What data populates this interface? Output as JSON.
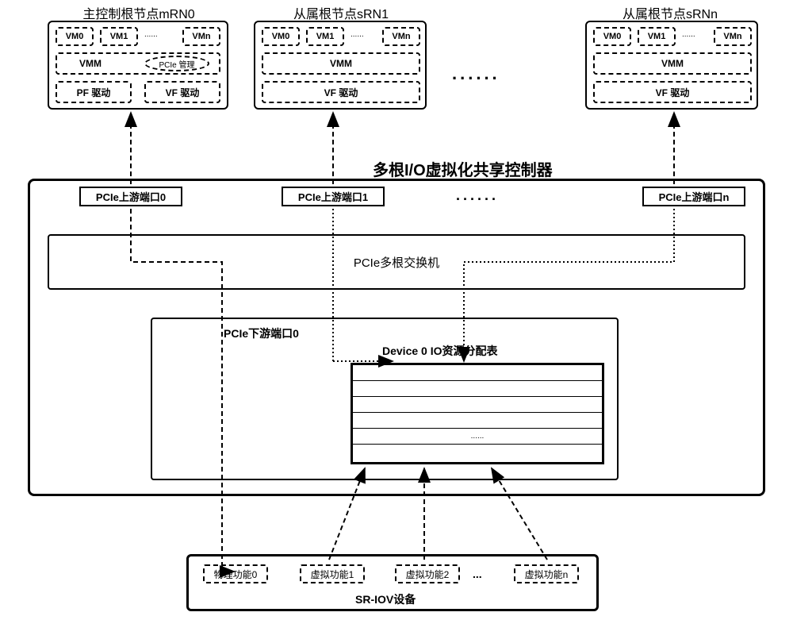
{
  "nodes": {
    "master": {
      "title": "主控制根节点mRN0",
      "vms": [
        "VM0",
        "VM1",
        "VMn"
      ],
      "vmm": "VMM",
      "pcie_mgmt": "PCIe 管理",
      "pf_driver": "PF 驱动",
      "vf_driver": "VF 驱动"
    },
    "slave1": {
      "title": "从属根节点sRN1",
      "vms": [
        "VM0",
        "VM1",
        "VMn"
      ],
      "vmm": "VMM",
      "vf_driver": "VF 驱动"
    },
    "slaven": {
      "title": "从属根节点sRNn",
      "vms": [
        "VM0",
        "VM1",
        "VMn"
      ],
      "vmm": "VMM",
      "vf_driver": "VF 驱动"
    }
  },
  "controller": {
    "title": "多根I/O虚拟化共享控制器",
    "upstream_ports": [
      "PCIe上游端口0",
      "PCIe上游端口1",
      "PCIe上游端口n"
    ],
    "switch": "PCIe多根交换机",
    "downstream": {
      "title": "PCIe下游端口0",
      "table_title": "Device 0 IO资源分配表"
    }
  },
  "sriov": {
    "title": "SR-IOV设备",
    "functions": [
      "物理功能0",
      "虚拟功能1",
      "虚拟功能2",
      "虚拟功能n"
    ]
  },
  "ellipsis": "......",
  "dots3": "..."
}
